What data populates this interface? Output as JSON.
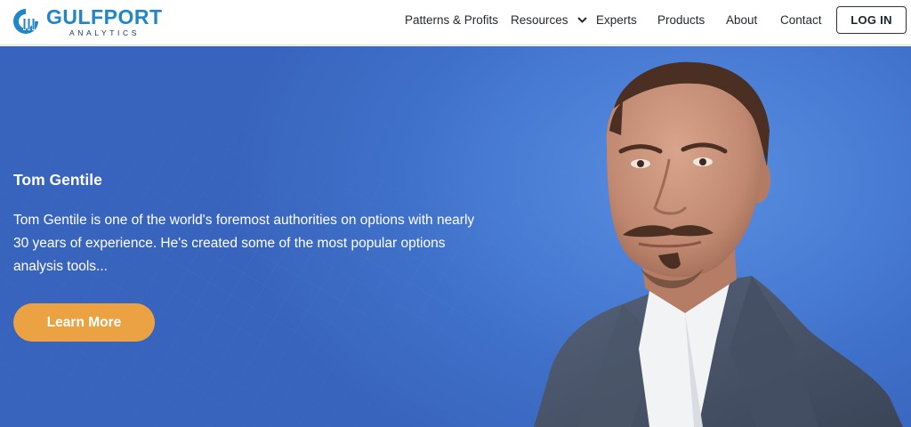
{
  "brand": {
    "name": "GULFPORT",
    "tagline": "ANALYTICS",
    "logo_icon": "gulfport-logo-icon",
    "primary_color": "#1f86c8",
    "secondary_color": "#123a63"
  },
  "nav": {
    "items": [
      {
        "label": "Patterns & Profits"
      },
      {
        "label": "Resources",
        "icon": "chevron-down-icon"
      },
      {
        "label": "Experts"
      },
      {
        "label": "Products"
      },
      {
        "label": "About"
      },
      {
        "label": "Contact"
      }
    ],
    "login_label": "LOG IN"
  },
  "hero": {
    "title": "Tom Gentile",
    "description": "Tom Gentile is one of the world's foremost authorities on options with nearly 30 years of experience. He's created some of the most popular options analysis tools...",
    "cta_label": "Learn More",
    "cta_color": "#eaa243",
    "background_color": "#4472cb",
    "portrait_icon": "expert-portrait-image"
  }
}
